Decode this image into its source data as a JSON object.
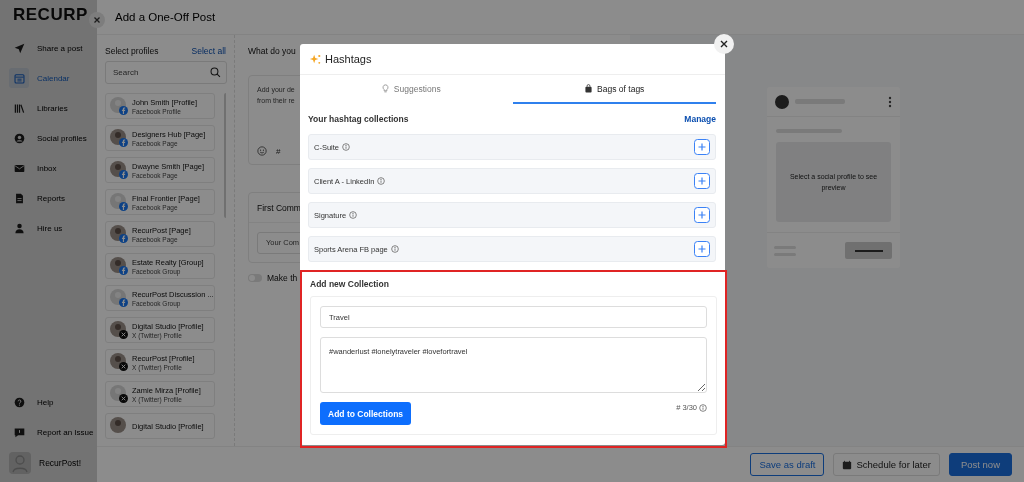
{
  "sidebar": {
    "logo": "RECURP",
    "items": [
      {
        "label": "Share a post",
        "selected": false
      },
      {
        "label": "Calendar",
        "selected": true
      },
      {
        "label": "Libraries",
        "selected": false
      },
      {
        "label": "Social profiles",
        "selected": false
      },
      {
        "label": "Inbox",
        "selected": false
      },
      {
        "label": "Reports",
        "selected": false
      },
      {
        "label": "Hire us",
        "selected": false
      }
    ],
    "bottom_items": [
      {
        "label": "Help",
        "selected": false
      },
      {
        "label": "Report an Issue",
        "selected": false
      }
    ],
    "user": {
      "name": "RecurPost!"
    }
  },
  "post_panel": {
    "title": "Add a One-Off Post",
    "profiles": {
      "heading": "Select profiles",
      "select_all": "Select all",
      "search": {
        "placeholder": "Search"
      },
      "items": [
        {
          "name": "John Smith [Profile]",
          "type": "Facebook Profile",
          "kind": "facebook"
        },
        {
          "name": "Designers Hub [Page]",
          "type": "Facebook Page",
          "kind": "facebook"
        },
        {
          "name": "Dwayne Smith [Page]",
          "type": "Facebook Page",
          "kind": "facebook"
        },
        {
          "name": "Final Frontier [Page]",
          "type": "Facebook Page",
          "kind": "facebook"
        },
        {
          "name": "RecurPost [Page]",
          "type": "Facebook Page",
          "kind": "facebook"
        },
        {
          "name": "Estate Realty [Group]",
          "type": "Facebook Group",
          "kind": "facebook"
        },
        {
          "name": "RecurPost Discussion ...",
          "type": "Facebook Group",
          "kind": "facebook"
        },
        {
          "name": "Digital Studio [Profile]",
          "type": "X (Twitter) Profile",
          "kind": "x"
        },
        {
          "name": "RecurPost [Profile]",
          "type": "X (Twitter) Profile",
          "kind": "x"
        },
        {
          "name": "Zamie Mirza [Profile]",
          "type": "X (Twitter) Profile",
          "kind": "x"
        },
        {
          "name": "Digital Studio [Profile]"
        }
      ]
    },
    "compose": {
      "heading": "What do you",
      "editor_hint": [
        "Add your de",
        "from their re"
      ],
      "hashtag_button": "#",
      "first_comment": {
        "heading": "First Comm",
        "placeholder": "Your Com"
      },
      "toggle": {
        "label": "Make th",
        "on": false
      }
    },
    "preview": {
      "message": "Select a social profile to see preview"
    },
    "footer": {
      "buttons": [
        {
          "label": "Save as draft",
          "kind": "outline"
        },
        {
          "label": "Schedule for later",
          "kind": "schedule"
        },
        {
          "label": "Post now",
          "kind": "primary"
        }
      ]
    }
  },
  "hashtags_modal": {
    "title": "Hashtags",
    "tabs": [
      {
        "label": "Suggestions",
        "selected": false
      },
      {
        "label": "Bags of tags",
        "selected": true
      }
    ],
    "collections_heading": "Your hashtag collections",
    "manage_link": "Manage",
    "collections": [
      {
        "name": "C-Suite"
      },
      {
        "name": "Client A - LinkedIn"
      },
      {
        "name": "Signature"
      },
      {
        "name": "Sports Arena FB page"
      }
    ],
    "new_collection": {
      "heading": "Add new Collection",
      "highlighted": true,
      "name_value": "Travel",
      "tags_value": "#wanderlust #lonelytraveler #lovefortravel",
      "submit": "Add to Collections",
      "counter": "# 3/30"
    }
  }
}
